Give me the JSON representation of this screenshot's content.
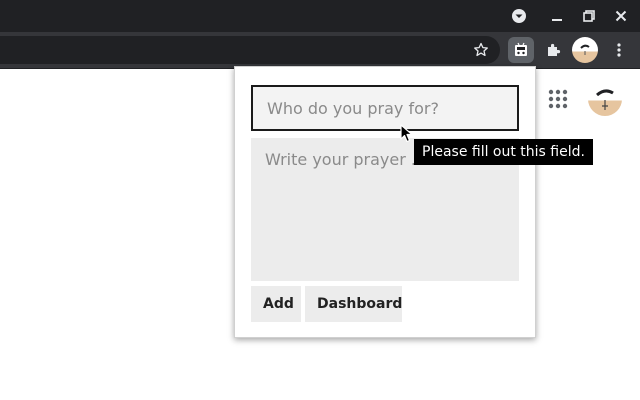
{
  "browser": {
    "window_controls": {
      "tab_search_icon": "chevron-down-circle-icon",
      "minimize_icon": "minimize-icon",
      "restore_icon": "restore-icon",
      "close_icon": "close-icon"
    },
    "toolbar": {
      "bookmark_icon": "star-icon",
      "active_extension_icon": "prayer-extension-icon",
      "extensions_icon": "puzzle-icon",
      "profile_icon": "avatar",
      "menu_icon": "kebab-menu-icon"
    }
  },
  "page": {
    "apps_icon": "apps-grid-icon",
    "avatar_icon": "avatar"
  },
  "popup": {
    "name_field": {
      "placeholder": "Who do you pray for?",
      "value": ""
    },
    "prayer_field": {
      "placeholder": "Write your prayer ...",
      "value": ""
    },
    "add_label": "Add",
    "dashboard_label": "Dashboard"
  },
  "validation_tooltip": "Please fill out this field.",
  "colors": {
    "titlebar": "#202124",
    "toolbar": "#35363a",
    "input_bg": "#f3f3f3",
    "textarea_bg": "#ececec",
    "tooltip_bg": "#000000"
  }
}
